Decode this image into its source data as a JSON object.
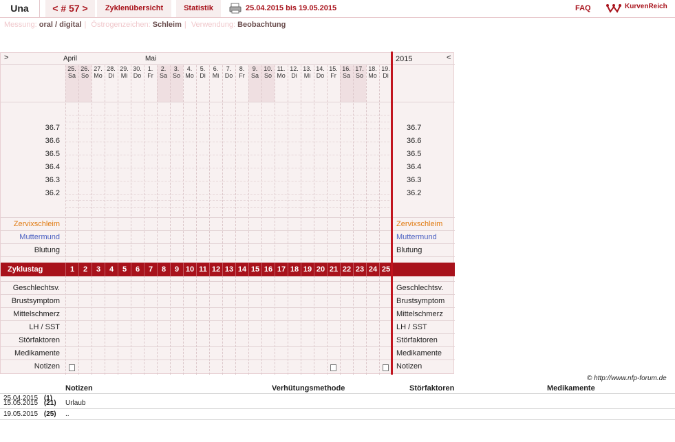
{
  "header": {
    "user": "Una",
    "cycle": "< # 57 >",
    "tab_overview": "Zyklenübersicht",
    "tab_stats": "Statistik",
    "range": "25.04.2015 bis 19.05.2015",
    "faq": "FAQ",
    "brand": "KurvenReich"
  },
  "subheader": {
    "m_label": "Messung:",
    "m_val": "oral / digital",
    "o_label": "Östrogenzeichen:",
    "o_val": "Schleim",
    "v_label": "Verwendung:",
    "v_val": "Beobachtung"
  },
  "grid": {
    "nav_left": ">",
    "nav_right": "<",
    "year": "2015",
    "month1": "April",
    "month2": "Mai",
    "days": [
      [
        "25.",
        "Sa"
      ],
      [
        "26.",
        "So"
      ],
      [
        "27.",
        "Mo"
      ],
      [
        "28.",
        "Di"
      ],
      [
        "29.",
        "Mi"
      ],
      [
        "30.",
        "Do"
      ],
      [
        "1.",
        "Fr"
      ],
      [
        "2.",
        "Sa"
      ],
      [
        "3.",
        "So"
      ],
      [
        "4.",
        "Mo"
      ],
      [
        "5.",
        "Di"
      ],
      [
        "6.",
        "Mi"
      ],
      [
        "7.",
        "Do"
      ],
      [
        "8.",
        "Fr"
      ],
      [
        "9.",
        "Sa"
      ],
      [
        "10.",
        "So"
      ],
      [
        "11.",
        "Mo"
      ],
      [
        "12.",
        "Di"
      ],
      [
        "13.",
        "Mi"
      ],
      [
        "14.",
        "Do"
      ],
      [
        "15.",
        "Fr"
      ],
      [
        "16.",
        "Sa"
      ],
      [
        "17.",
        "So"
      ],
      [
        "18.",
        "Mo"
      ],
      [
        "19.",
        "Di"
      ]
    ],
    "temps": [
      "36.7",
      "36.6",
      "36.5",
      "36.4",
      "36.3",
      "36.2"
    ],
    "cervix": "Zervixschleim",
    "mm": "Muttermund",
    "bleeding": "Blutung",
    "cycle_day_label": "Zyklustag",
    "cycle_days": [
      "1",
      "2",
      "3",
      "4",
      "5",
      "6",
      "7",
      "8",
      "9",
      "10",
      "11",
      "12",
      "13",
      "14",
      "15",
      "16",
      "17",
      "18",
      "19",
      "20",
      "21",
      "22",
      "23",
      "24",
      "25"
    ],
    "rows": [
      "Geschlechtsv.",
      "Brustsymptom",
      "Mittelschmerz",
      "LH / SST",
      "Störfaktoren",
      "Medikamente",
      "Notizen"
    ]
  },
  "credit": "© http://www.nfp-forum.de",
  "bottom": {
    "h_notes": "Notizen",
    "h_method": "Verhütungsmethode",
    "h_dist": "Störfaktoren",
    "h_meds": "Medikamente",
    "r1_date": "25.04.2015",
    "r1_day": "(1)",
    "r2_date": "15.05.2015",
    "r2_day": "(21)",
    "r2_note": "Urlaub",
    "r3_date": "19.05.2015",
    "r3_day": "(25)",
    "r3_note": ".."
  },
  "colors": {
    "accent": "#a8121b",
    "cervix": "#e07a10",
    "mm": "#4a5fc1"
  }
}
